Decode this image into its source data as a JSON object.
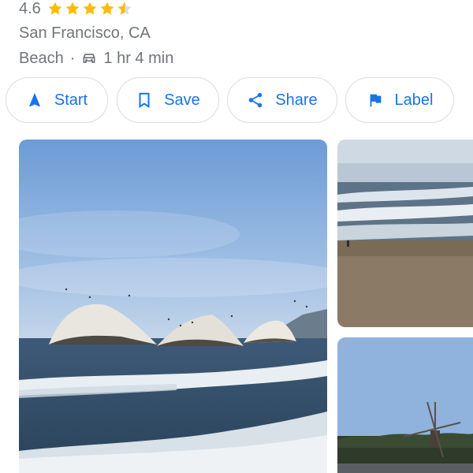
{
  "place": {
    "rating": "4.6",
    "rating_value": 4.6,
    "rating_max": 5,
    "location": "San Francisco, CA",
    "category": "Beach",
    "separator": "·",
    "drive_time": "1 hr 4 min"
  },
  "actions": {
    "start_label": "Start",
    "save_label": "Save",
    "share_label": "Share",
    "label_label": "Label"
  },
  "icons": {
    "star": "star-icon",
    "car": "car-icon",
    "start": "navigation-arrow-icon",
    "save": "bookmark-icon",
    "share": "share-icon",
    "label": "flag-icon"
  },
  "colors": {
    "accent": "#1a73e8",
    "star": "#fbbc04",
    "text_secondary": "#70757a",
    "chip_border": "#dadce0"
  },
  "photos": [
    "seal-rocks-ocean-photo",
    "beach-surf-photo",
    "windmill-park-photo"
  ]
}
